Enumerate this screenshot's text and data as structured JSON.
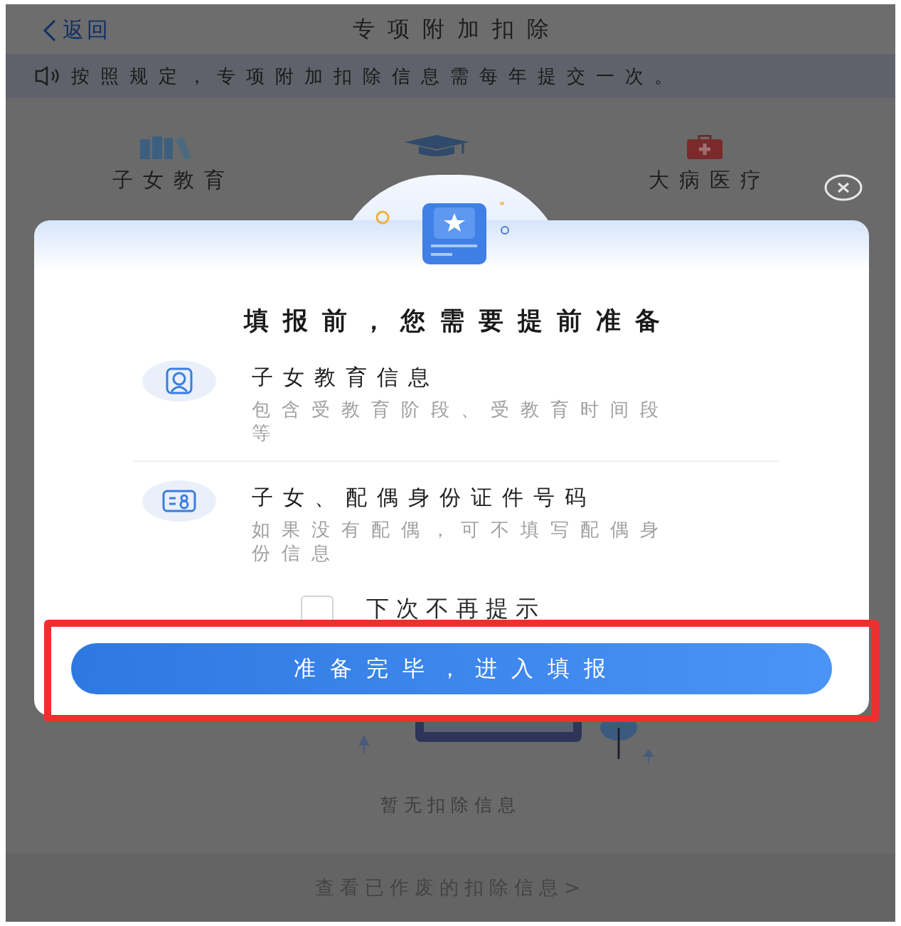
{
  "header": {
    "back": "返回",
    "title": "专项附加扣除"
  },
  "notice": {
    "text": "按照规定，专项附加扣除信息需每年提交一次。"
  },
  "categories": [
    {
      "kind": "books",
      "label": "子女教育"
    },
    {
      "kind": "cap"
    },
    {
      "kind": "medkit",
      "label": "大病医疗"
    }
  ],
  "empty_state": {
    "text": "暂无扣除信息"
  },
  "footer_link": "查看已作废的扣除信息>",
  "dialog": {
    "title": "填报前，您需要提前准备",
    "items": [
      {
        "kind": "child",
        "title": "子女教育信息",
        "description": "包含受教育阶段、受教育时间段等"
      },
      {
        "kind": "id",
        "title": "子女、配偶身份证件号码",
        "description": "如果没有配偶，可不填写配偶身份信息"
      }
    ],
    "dont_show_again": {
      "label": "下次不再提示",
      "checked": false
    },
    "confirm_button": "准备完毕，进入填报"
  },
  "annotation": {
    "kind": "frame"
  }
}
